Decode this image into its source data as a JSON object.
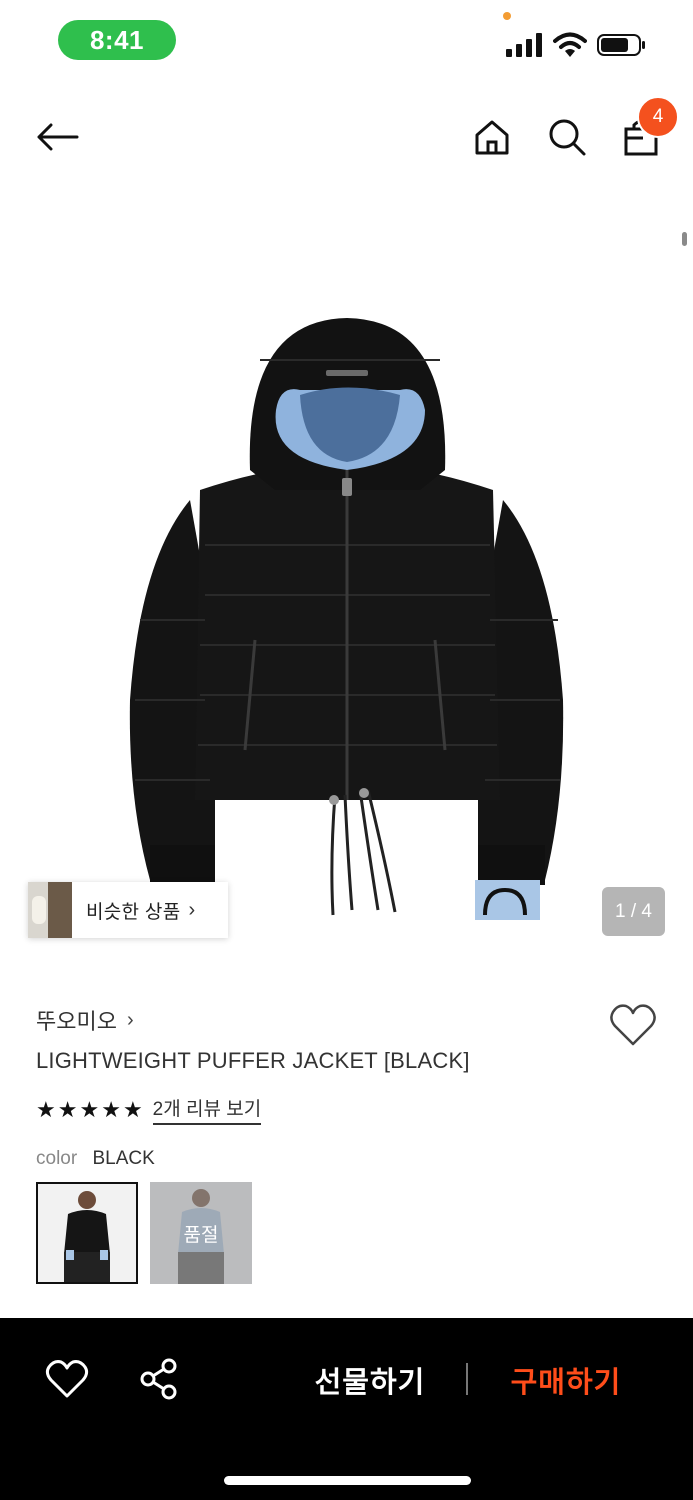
{
  "status_bar": {
    "time": "8:41",
    "icons": [
      "signal-icon",
      "wifi-icon",
      "battery-icon"
    ]
  },
  "nav": {
    "icons": [
      "back-arrow-icon",
      "home-icon",
      "search-icon",
      "shopping-bag-icon"
    ],
    "cart_count": "4"
  },
  "gallery": {
    "similar_label": "비슷한 상품",
    "page_counter": "1 / 4",
    "image": "black-puffer-jacket-photo"
  },
  "product": {
    "brand": "뚜오미오",
    "title": "LIGHTWEIGHT PUFFER JACKET [BLACK]",
    "rating_stars": 5,
    "review_link": "2개 리뷰 보기",
    "color_label": "color",
    "color_value": "BLACK",
    "swatches": [
      {
        "state": "selected",
        "label": ""
      },
      {
        "state": "sold-out",
        "label": "품절"
      }
    ]
  },
  "bottom_bar": {
    "gift_label": "선물하기",
    "buy_label": "구매하기",
    "colors": {
      "buy": "#ff4d1a",
      "background": "#000000"
    }
  },
  "colors": {
    "time_pill": "#2fbf4d",
    "badge": "#f4511e"
  }
}
